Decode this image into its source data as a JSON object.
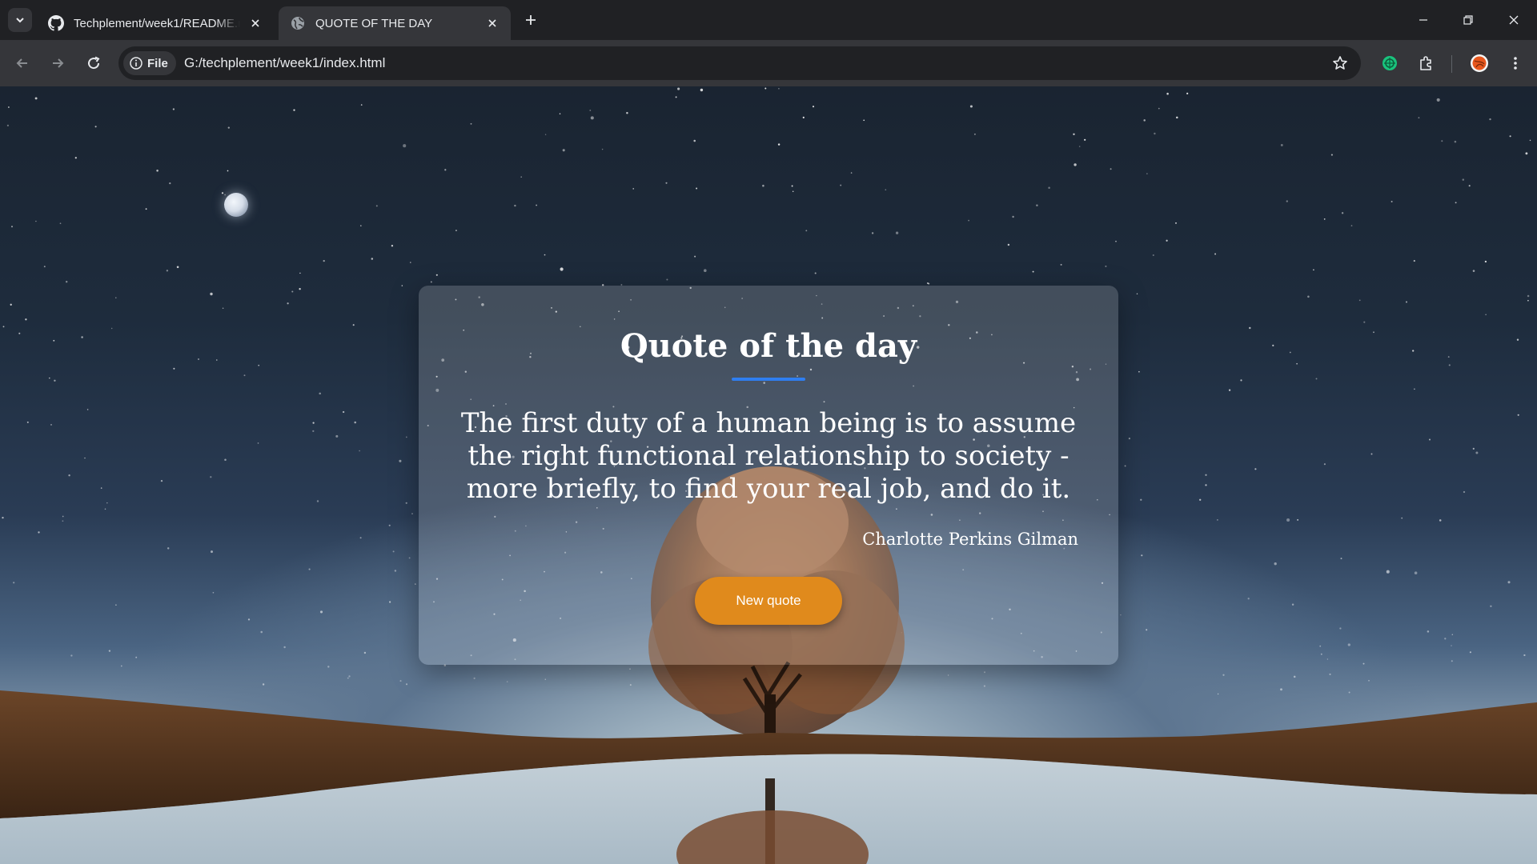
{
  "browser": {
    "tabs": [
      {
        "title": "Techplement/week1/README.m",
        "icon": "github-icon",
        "active": false
      },
      {
        "title": "QUOTE OF THE DAY",
        "icon": "globe-icon",
        "active": true
      }
    ],
    "address_bar": {
      "site_chip": "File",
      "url": "G:/techplement/week1/index.html"
    }
  },
  "page": {
    "title": "Quote of the day",
    "quote": "The first duty of a human being is to assume the right functional relationship to society - more briefly, to find your real job, and do it.",
    "author": "Charlotte Perkins Gilman",
    "button_label": "New quote"
  },
  "colors": {
    "accent_underline": "#2f7ef0",
    "button": "#e08a1c",
    "chrome_dark": "#202124",
    "chrome_mid": "#35363a"
  }
}
